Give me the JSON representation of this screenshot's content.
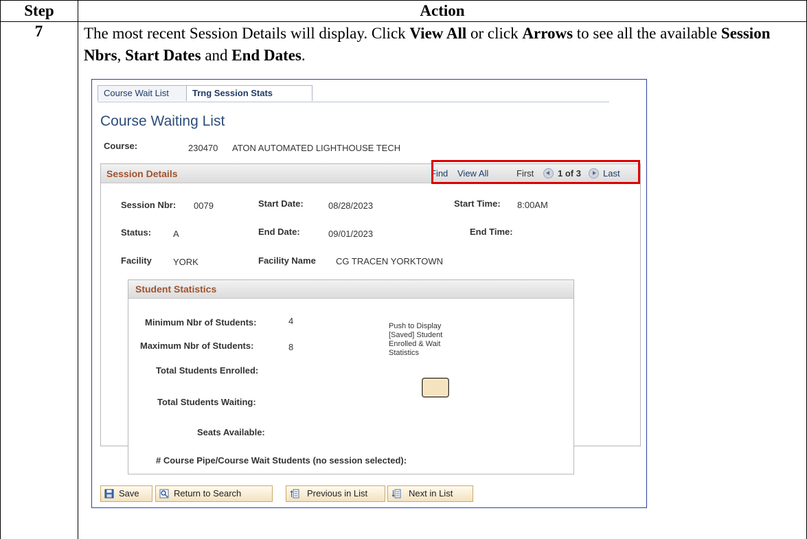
{
  "table": {
    "header_step": "Step",
    "header_action": "Action",
    "step_number": "7",
    "instruction_parts": [
      {
        "text": "The most recent Session Details will display. Click ",
        "bold": false
      },
      {
        "text": "View All",
        "bold": true
      },
      {
        "text": " or click ",
        "bold": false
      },
      {
        "text": "Arrows",
        "bold": true
      },
      {
        "text": " to see all the available ",
        "bold": false
      },
      {
        "text": "Session Nbrs",
        "bold": true
      },
      {
        "text": ", ",
        "bold": false
      },
      {
        "text": "Start Dates",
        "bold": true
      },
      {
        "text": " and ",
        "bold": false
      },
      {
        "text": "End Dates",
        "bold": true
      },
      {
        "text": ".",
        "bold": false
      }
    ]
  },
  "screen": {
    "tabs": [
      {
        "label": "Course Wait List",
        "active": false
      },
      {
        "label": "Trng Session Stats",
        "active": true
      }
    ],
    "page_title": "Course Waiting List",
    "course_label": "Course:",
    "course_id": "230470",
    "course_name": "ATON AUTOMATED LIGHTHOUSE TECH",
    "session_details": {
      "title": "Session Details",
      "nav": {
        "find": "Find",
        "view_all": "View All",
        "first": "First",
        "position": "1 of 3",
        "last": "Last"
      },
      "session_nbr_label": "Session Nbr:",
      "session_nbr": "0079",
      "start_date_label": "Start Date:",
      "start_date": "08/28/2023",
      "start_time_label": "Start Time:",
      "start_time": "8:00AM",
      "status_label": "Status:",
      "status": "A",
      "end_date_label": "End Date:",
      "end_date": "09/01/2023",
      "end_time_label": "End Time:",
      "facility_label": "Facility",
      "facility": "YORK",
      "facility_name_label": "Facility Name",
      "facility_name": "CG TRACEN YORKTOWN"
    },
    "student_statistics": {
      "title": "Student Statistics",
      "min_label": "Minimum Nbr of Students:",
      "min_value": "4",
      "max_label": "Maximum Nbr of Students:",
      "max_value": "8",
      "enrolled_label": "Total Students Enrolled:",
      "waiting_label": "Total Students Waiting:",
      "seats_label": "Seats Available:",
      "pipe_label": "# Course Pipe/Course Wait Students (no session selected):",
      "push_text": "Push to Display [Saved] Student Enrolled & Wait Statistics"
    },
    "buttons": {
      "save": "Save",
      "return": "Return to Search",
      "previous": "Previous in List",
      "next": "Next in List"
    },
    "colors": {
      "link": "#1f3b66",
      "section_title": "#a0522d",
      "highlight": "#e00000",
      "frame": "#2c3ea0"
    }
  }
}
